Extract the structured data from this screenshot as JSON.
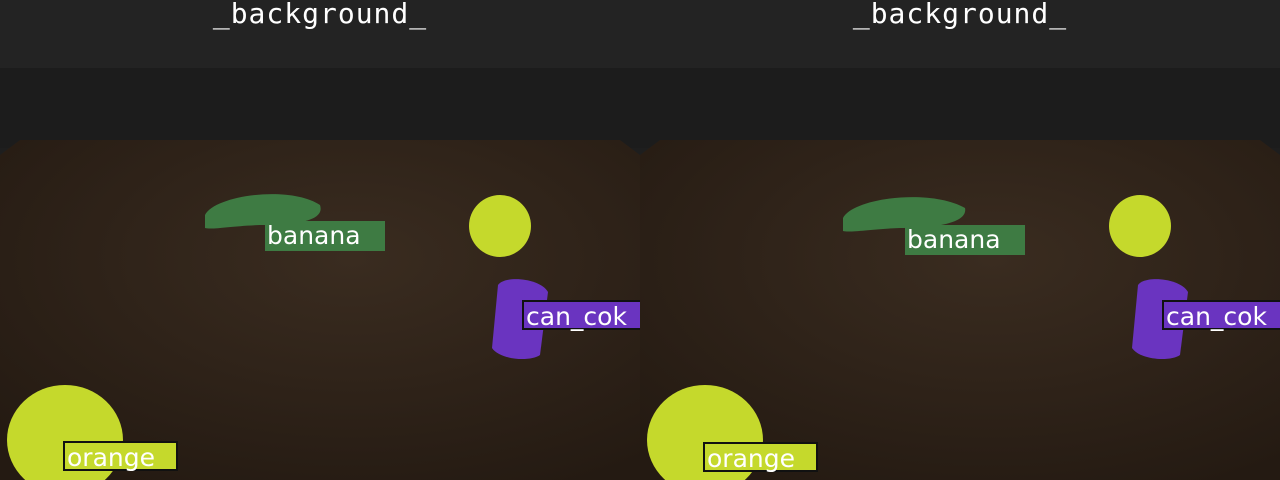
{
  "panels": [
    {
      "background_label": "_background_",
      "labels": {
        "banana": "banana",
        "can_coke": "can_cok",
        "orange": "orange"
      }
    },
    {
      "background_label": "_background_",
      "labels": {
        "banana": "banana",
        "can_coke": "can_cok",
        "orange": "orange"
      }
    }
  ],
  "colors": {
    "banana": "#3e7b43",
    "can_coke": "#6a34c0",
    "orange": "#c5d92c",
    "table": "#2c2118",
    "background": "#1e1e1e"
  }
}
